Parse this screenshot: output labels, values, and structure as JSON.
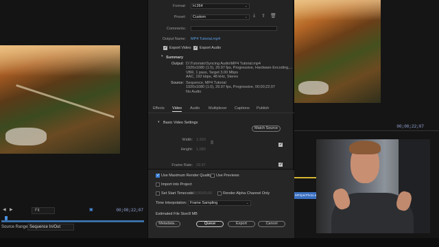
{
  "source_monitor": {
    "zoom": "Fit",
    "timecode": "00;00;22;07",
    "source_range_label": "Source Range",
    "source_range_value": "Sequence In/Out"
  },
  "export": {
    "format_label": "Format:",
    "format_value": "H.264",
    "preset_label": "Preset:",
    "preset_value": "Custom",
    "comments_label": "Comments:",
    "output_name_label": "Output Name:",
    "output_name_value": "MP4 Tutorial.mp4",
    "export_video_label": "Export Video",
    "export_audio_label": "Export Audio",
    "summary_title": "Summary",
    "output_key": "Output:",
    "output_lines": [
      "D:\\Tutorials\\Syncing Audio\\MP4 Tutorial.mp4",
      "1920x1080 (1.0), 29.97 fps, Progressive, Hardware Encoding,...",
      "VBR, 1 pass, Target 3.00 Mbps",
      "AAC, 192 kbps, 48 kHz, Stereo"
    ],
    "source_key": "Source:",
    "source_lines": [
      "Sequence, MP4 Tutorial",
      "1920x1080 (1.0), 29.97 fps, Progressive, 00;00;22;07",
      "No Audio"
    ],
    "tabs": [
      "Effects",
      "Video",
      "Audio",
      "Multiplexer",
      "Captions",
      "Publish"
    ],
    "active_tab": "Video",
    "basic_video_settings": "Basic Video Settings",
    "match_source": "Match Source",
    "width_label": "Width:",
    "width_value": "1,920",
    "height_label": "Height:",
    "height_value": "1,080",
    "frame_rate_label": "Frame Rate:",
    "frame_rate_value": "29.97",
    "use_max_render_quality": "Use Maximum Render Quality",
    "use_previews": "Use Previews",
    "import_into_project": "Import into Project",
    "set_start_timecode": "Set Start Timecode",
    "start_timecode_value": "00;00;00;00",
    "render_alpha": "Render Alpha Channel Only",
    "time_interpolation_label": "Time Interpolation:",
    "time_interpolation_value": "Frame Sampling",
    "estimated_file_size_label": "Estimated File Size:",
    "estimated_file_size_value": "8 MB",
    "metadata_button": "Metadata...",
    "queue_button": "Queue",
    "export_button": "Export",
    "cancel_button": "Cancel"
  },
  "program_monitor": {
    "timecode": "00;00;22;07",
    "clip_label": "MP4perPhoto.alpha"
  },
  "icons": {
    "save_preset": "download-icon",
    "import_preset": "import-icon",
    "delete_preset": "trash-icon",
    "link_dimensions": "chain-link-icon"
  }
}
